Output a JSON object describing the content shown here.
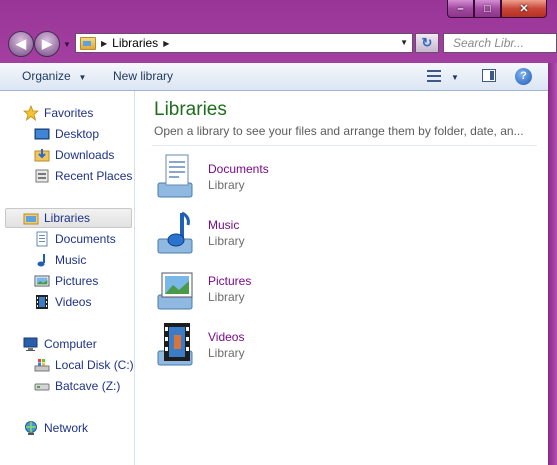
{
  "window": {
    "controls": {
      "minimize": "–",
      "maximize": "□",
      "close": "✕"
    }
  },
  "address_bar": {
    "crumbs": [
      "Libraries"
    ],
    "search_placeholder": "Search Libr..."
  },
  "toolbar": {
    "organize_label": "Organize",
    "new_library_label": "New library"
  },
  "nav_pane": {
    "favorites": {
      "label": "Favorites",
      "items": [
        "Desktop",
        "Downloads",
        "Recent Places"
      ]
    },
    "libraries": {
      "label": "Libraries",
      "items": [
        "Documents",
        "Music",
        "Pictures",
        "Videos"
      ]
    },
    "computer": {
      "label": "Computer",
      "items": [
        "Local Disk (C:)",
        "Batcave (Z:)"
      ]
    },
    "network": {
      "label": "Network"
    }
  },
  "main": {
    "title": "Libraries",
    "subtitle": "Open a library to see your files and arrange them by folder, date, an...",
    "libraries": [
      {
        "name": "Documents",
        "type": "Library",
        "icon": "documents-library-icon"
      },
      {
        "name": "Music",
        "type": "Library",
        "icon": "music-library-icon"
      },
      {
        "name": "Pictures",
        "type": "Library",
        "icon": "pictures-library-icon"
      },
      {
        "name": "Videos",
        "type": "Library",
        "icon": "videos-library-icon"
      }
    ]
  },
  "colors": {
    "frame": "#a23fa0",
    "link": "#7a0a8a",
    "heading": "#1e6e1e",
    "nav_text": "#1e3287"
  }
}
